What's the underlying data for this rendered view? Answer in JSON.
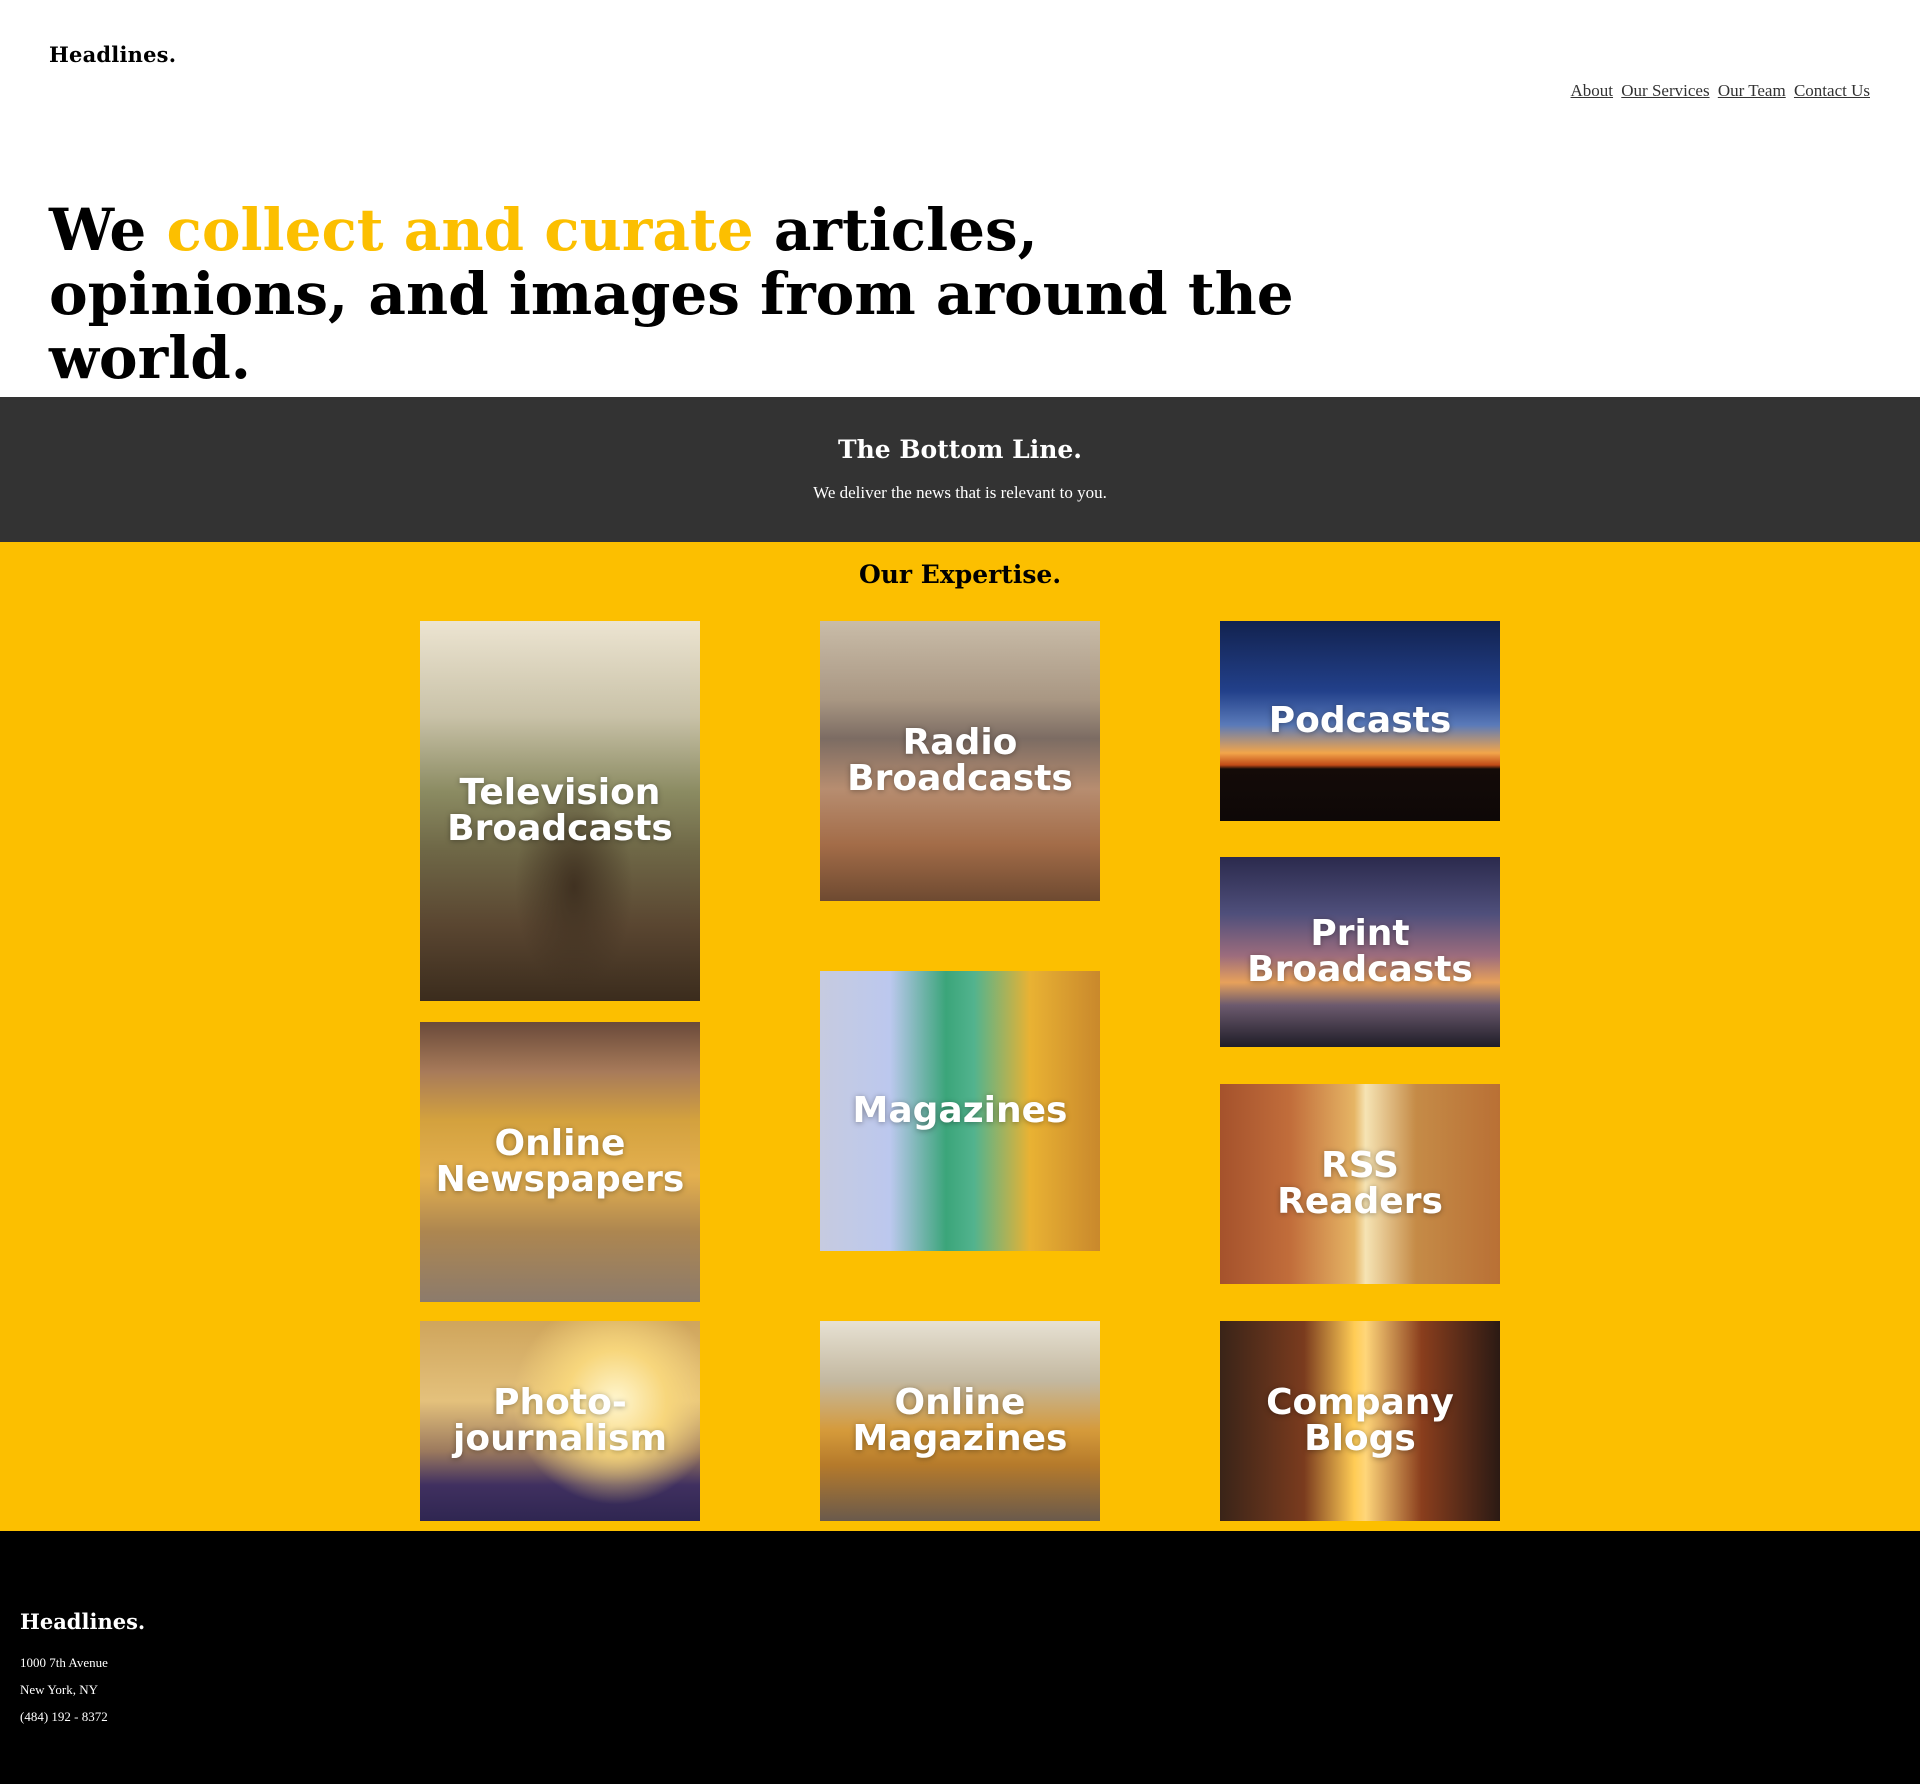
{
  "header": {
    "logo": "Headlines.",
    "nav": [
      "About",
      "Our Services",
      "Our Team",
      "Contact Us"
    ]
  },
  "hero": {
    "prefix": "We",
    "highlight": "collect and curate",
    "suffix": "articles, opinions, and images from around the world.",
    "highlight_color": "#fcbf00"
  },
  "bottom_line": {
    "title": "The Bottom Line.",
    "subtitle": "We deliver the news that is relevant to you."
  },
  "expertise": {
    "title": "Our Expertise.",
    "background_color": "#fcbf00",
    "tiles": [
      {
        "label_1": "Television",
        "label_2": "Broadcasts"
      },
      {
        "label_1": "Online",
        "label_2": "Newspapers"
      },
      {
        "label_1": "Photo-",
        "label_2": "journalism"
      },
      {
        "label_1": "Radio",
        "label_2": "Broadcasts"
      },
      {
        "label_1": "Magazines",
        "label_2": ""
      },
      {
        "label_1": "Online",
        "label_2": "Magazines"
      },
      {
        "label_1": "Podcasts",
        "label_2": ""
      },
      {
        "label_1": "Print",
        "label_2": "Broadcasts"
      },
      {
        "label_1": "RSS",
        "label_2": "Readers"
      },
      {
        "label_1": "Company",
        "label_2": "Blogs"
      }
    ]
  },
  "footer": {
    "logo": "Headlines.",
    "address_1": "1000 7th Avenue",
    "address_2": "New York, NY",
    "phone": "(484) 192 - 8372"
  }
}
